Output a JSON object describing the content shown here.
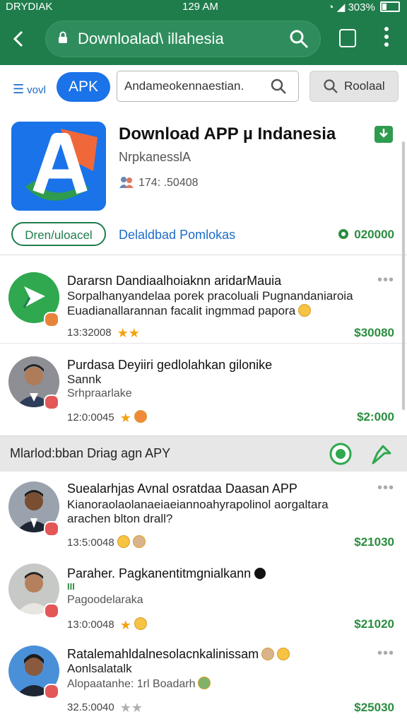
{
  "status": {
    "left": "DRYDIAK",
    "time": "129 AM",
    "battery": "303%"
  },
  "browser": {
    "url": "Downloalad\\ illahesia",
    "tab_count": ""
  },
  "toolbar": {
    "menu_label": "vovl",
    "apk_label": "APK",
    "search_placeholder": "Andameokennaestian.",
    "search_button": "Roolaal"
  },
  "hero": {
    "title": "Download APP µ Indanesia",
    "subtitle": "NrpkanesslA",
    "meta": "174: .50408",
    "download_button": "Dren/uloacel",
    "link": "Delaldbad Pomlokas",
    "price": "020000"
  },
  "items": [
    {
      "title": "Dararsn Dandiaalhoiaknn aridarMauia",
      "line1": "Sorpalhanyandelaa porek pracoluali Pugnandaniaroia",
      "line2": "Euadianallarannan facalit ingmmad papora",
      "time": "13:32008",
      "stars": "★★",
      "price": "$30080"
    },
    {
      "title": "Purdasa Deyiiri gedlolahkan gilonike",
      "line1": "Sannk",
      "line2": "Srhpraarlake",
      "time": "12:0:0045",
      "stars": "★",
      "price": "$2:000"
    },
    {
      "title": "Suealarhjas Avnal osratdaa Daasan APP",
      "line1": "Kianoraolaolanaeiaeiannoahyrapolinol aorgaltara",
      "line2": "arachen blton drall?",
      "time": "13:5:0048",
      "stars": "",
      "price": "$21030"
    },
    {
      "title": "Paraher. Pagkanentitmgnialkann",
      "line1": "III",
      "line2": "Pagoodelaraka",
      "time": "13:0:0048",
      "stars": "★",
      "price": "$21020"
    },
    {
      "title": "Ratalemahldalnesolacnkalinissam",
      "line1": "Aonlsalatalk",
      "line2": "Alopaatanhe: 1rl Boadarh",
      "time": "32.5:0040",
      "stars": "★★",
      "price": "$25030"
    }
  ],
  "section": {
    "title": "Mlarlod:bban Driag agn APY"
  }
}
